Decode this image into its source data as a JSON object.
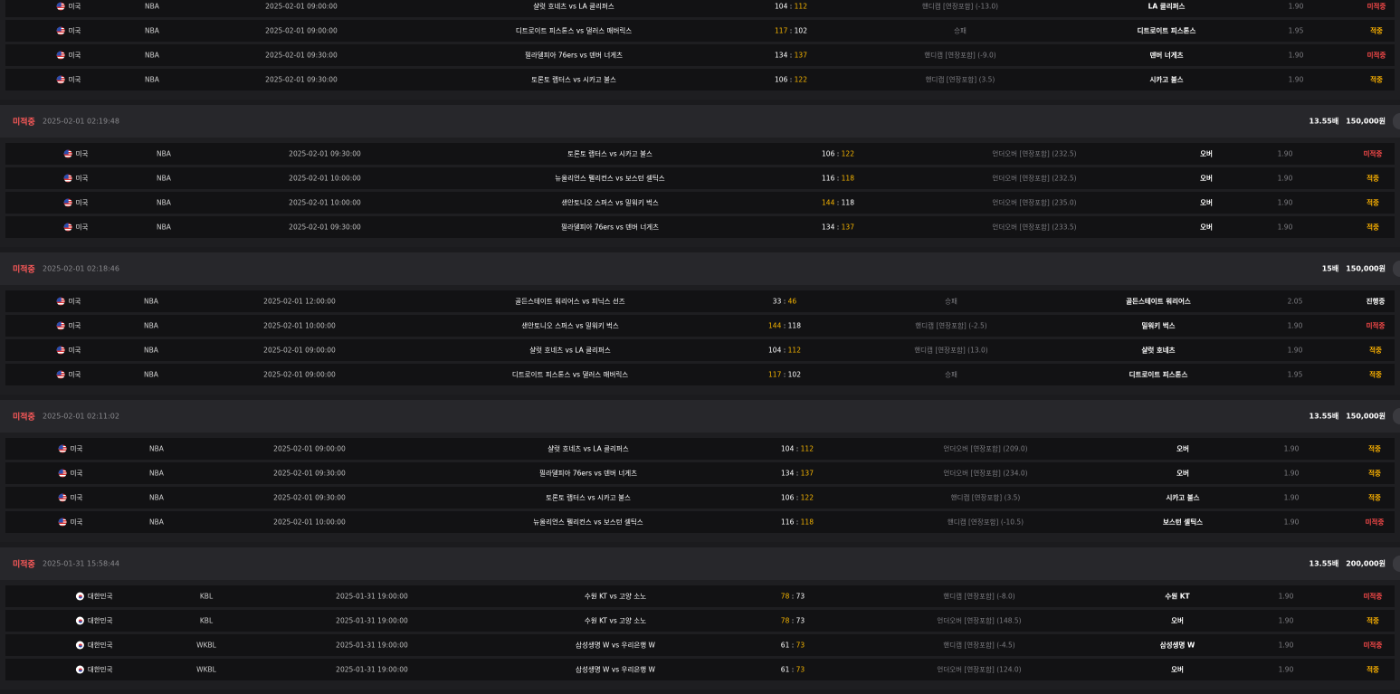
{
  "groups": [
    {
      "status": null,
      "bet_time": null,
      "odds_total": null,
      "stake": null,
      "rows": [
        {
          "country": "미국",
          "flag": "us-flag",
          "league": "NBA",
          "time": "2025-02-01 09:00:00",
          "match": "샬럿 호네츠 vs LA 클리퍼스",
          "score_home": "104",
          "score_away": "112",
          "hi": "away",
          "bet_type": "핸디캡 [연장포함] (-13.0)",
          "pick": "LA 클리퍼스",
          "odds": "1.90",
          "result": "미적중",
          "result_kind": "miss"
        },
        {
          "country": "미국",
          "flag": "us-flag",
          "league": "NBA",
          "time": "2025-02-01 09:00:00",
          "match": "디트로이트 피스톤스 vs 댈러스 매버릭스",
          "score_home": "117",
          "score_away": "102",
          "hi": "home",
          "bet_type": "승패",
          "pick": "디트로이트 피스톤스",
          "odds": "1.95",
          "result": "적중",
          "result_kind": "win"
        },
        {
          "country": "미국",
          "flag": "us-flag",
          "league": "NBA",
          "time": "2025-02-01 09:30:00",
          "match": "필라델피아 76ers vs 덴버 너게츠",
          "score_home": "134",
          "score_away": "137",
          "hi": "away",
          "bet_type": "핸디캡 [연장포함] (-9.0)",
          "pick": "덴버 너게츠",
          "odds": "1.90",
          "result": "미적중",
          "result_kind": "miss"
        },
        {
          "country": "미국",
          "flag": "us-flag",
          "league": "NBA",
          "time": "2025-02-01 09:30:00",
          "match": "토론토 랩터스 vs 시카고 불스",
          "score_home": "106",
          "score_away": "122",
          "hi": "away",
          "bet_type": "핸디캡 [연장포함] (3.5)",
          "pick": "시카고 불스",
          "odds": "1.90",
          "result": "적중",
          "result_kind": "win"
        }
      ]
    },
    {
      "status": "미적중",
      "bet_time": "2025-02-01 02:19:48",
      "odds_total": "13.55배",
      "stake": "150,000원",
      "rows": [
        {
          "country": "미국",
          "flag": "us-flag",
          "league": "NBA",
          "time": "2025-02-01 09:30:00",
          "match": "토론토 랩터스 vs 시카고 불스",
          "score_home": "106",
          "score_away": "122",
          "hi": "away",
          "bet_type": "언더오버 [연장포함] (232.5)",
          "pick": "오버",
          "odds": "1.90",
          "result": "미적중",
          "result_kind": "miss"
        },
        {
          "country": "미국",
          "flag": "us-flag",
          "league": "NBA",
          "time": "2025-02-01 10:00:00",
          "match": "뉴올리언스 펠리컨스 vs 보스턴 셀틱스",
          "score_home": "116",
          "score_away": "118",
          "hi": "away",
          "bet_type": "언더오버 [연장포함] (232.5)",
          "pick": "오버",
          "odds": "1.90",
          "result": "적중",
          "result_kind": "win"
        },
        {
          "country": "미국",
          "flag": "us-flag",
          "league": "NBA",
          "time": "2025-02-01 10:00:00",
          "match": "샌안토니오 스퍼스 vs 밀워키 벅스",
          "score_home": "144",
          "score_away": "118",
          "hi": "home",
          "bet_type": "언더오버 [연장포함] (235.0)",
          "pick": "오버",
          "odds": "1.90",
          "result": "적중",
          "result_kind": "win"
        },
        {
          "country": "미국",
          "flag": "us-flag",
          "league": "NBA",
          "time": "2025-02-01 09:30:00",
          "match": "필라델피아 76ers vs 덴버 너게츠",
          "score_home": "134",
          "score_away": "137",
          "hi": "away",
          "bet_type": "언더오버 [연장포함] (233.5)",
          "pick": "오버",
          "odds": "1.90",
          "result": "적중",
          "result_kind": "win"
        }
      ]
    },
    {
      "status": "미적중",
      "bet_time": "2025-02-01 02:18:46",
      "odds_total": "15배",
      "stake": "150,000원",
      "rows": [
        {
          "country": "미국",
          "flag": "us-flag",
          "league": "NBA",
          "time": "2025-02-01 12:00:00",
          "match": "골든스테이트 워리어스 vs 피닉스 선즈",
          "score_home": "33",
          "score_away": "46",
          "hi": "away",
          "bet_type": "승패",
          "pick": "골든스테이트 워리어스",
          "odds": "2.05",
          "result": "진행중",
          "result_kind": "live"
        },
        {
          "country": "미국",
          "flag": "us-flag",
          "league": "NBA",
          "time": "2025-02-01 10:00:00",
          "match": "샌안토니오 스퍼스 vs 밀워키 벅스",
          "score_home": "144",
          "score_away": "118",
          "hi": "home",
          "bet_type": "핸디캡 [연장포함] (-2.5)",
          "pick": "밀워키 벅스",
          "odds": "1.90",
          "result": "미적중",
          "result_kind": "miss"
        },
        {
          "country": "미국",
          "flag": "us-flag",
          "league": "NBA",
          "time": "2025-02-01 09:00:00",
          "match": "샬럿 호네츠 vs LA 클리퍼스",
          "score_home": "104",
          "score_away": "112",
          "hi": "away",
          "bet_type": "핸디캡 [연장포함] (13.0)",
          "pick": "샬럿 호네츠",
          "odds": "1.90",
          "result": "적중",
          "result_kind": "win"
        },
        {
          "country": "미국",
          "flag": "us-flag",
          "league": "NBA",
          "time": "2025-02-01 09:00:00",
          "match": "디트로이트 피스톤스 vs 댈러스 매버릭스",
          "score_home": "117",
          "score_away": "102",
          "hi": "home",
          "bet_type": "승패",
          "pick": "디트로이트 피스톤스",
          "odds": "1.95",
          "result": "적중",
          "result_kind": "win"
        }
      ]
    },
    {
      "status": "미적중",
      "bet_time": "2025-02-01 02:11:02",
      "odds_total": "13.55배",
      "stake": "150,000원",
      "rows": [
        {
          "country": "미국",
          "flag": "us-flag",
          "league": "NBA",
          "time": "2025-02-01 09:00:00",
          "match": "샬럿 호네츠 vs LA 클리퍼스",
          "score_home": "104",
          "score_away": "112",
          "hi": "away",
          "bet_type": "언더오버 [연장포함] (209.0)",
          "pick": "오버",
          "odds": "1.90",
          "result": "적중",
          "result_kind": "win"
        },
        {
          "country": "미국",
          "flag": "us-flag",
          "league": "NBA",
          "time": "2025-02-01 09:30:00",
          "match": "필라델피아 76ers vs 덴버 너게츠",
          "score_home": "134",
          "score_away": "137",
          "hi": "away",
          "bet_type": "언더오버 [연장포함] (234.0)",
          "pick": "오버",
          "odds": "1.90",
          "result": "적중",
          "result_kind": "win"
        },
        {
          "country": "미국",
          "flag": "us-flag",
          "league": "NBA",
          "time": "2025-02-01 09:30:00",
          "match": "토론토 랩터스 vs 시카고 불스",
          "score_home": "106",
          "score_away": "122",
          "hi": "away",
          "bet_type": "핸디캡 [연장포함] (3.5)",
          "pick": "시카고 불스",
          "odds": "1.90",
          "result": "적중",
          "result_kind": "win"
        },
        {
          "country": "미국",
          "flag": "us-flag",
          "league": "NBA",
          "time": "2025-02-01 10:00:00",
          "match": "뉴올리언스 펠리컨스 vs 보스턴 셀틱스",
          "score_home": "116",
          "score_away": "118",
          "hi": "away",
          "bet_type": "핸디캡 [연장포함] (-10.5)",
          "pick": "보스턴 셀틱스",
          "odds": "1.90",
          "result": "미적중",
          "result_kind": "miss"
        }
      ]
    },
    {
      "status": "미적중",
      "bet_time": "2025-01-31 15:58:44",
      "odds_total": "13.55배",
      "stake": "200,000원",
      "rows": [
        {
          "country": "대한민국",
          "flag": "korea-flag",
          "league": "KBL",
          "time": "2025-01-31 19:00:00",
          "match": "수원 KT vs 고양 소노",
          "score_home": "78",
          "score_away": "73",
          "hi": "home",
          "bet_type": "핸디캡 [연장포함] (-8.0)",
          "pick": "수원 KT",
          "odds": "1.90",
          "result": "미적중",
          "result_kind": "miss"
        },
        {
          "country": "대한민국",
          "flag": "korea-flag",
          "league": "KBL",
          "time": "2025-01-31 19:00:00",
          "match": "수원 KT vs 고양 소노",
          "score_home": "78",
          "score_away": "73",
          "hi": "home",
          "bet_type": "언더오버 [연장포함] (148.5)",
          "pick": "오버",
          "odds": "1.90",
          "result": "적중",
          "result_kind": "win"
        },
        {
          "country": "대한민국",
          "flag": "korea-flag",
          "league": "WKBL",
          "time": "2025-01-31 19:00:00",
          "match": "삼성생명 W vs 우리은행 W",
          "score_home": "61",
          "score_away": "73",
          "hi": "away",
          "bet_type": "핸디캡 [연장포함] (-4.5)",
          "pick": "삼성생명 W",
          "odds": "1.90",
          "result": "미적중",
          "result_kind": "miss"
        },
        {
          "country": "대한민국",
          "flag": "korea-flag",
          "league": "WKBL",
          "time": "2025-01-31 19:00:00",
          "match": "삼성생명 W vs 우리은행 W",
          "score_home": "61",
          "score_away": "73",
          "hi": "away",
          "bet_type": "언더오버 [연장포함] (124.0)",
          "pick": "오버",
          "odds": "1.90",
          "result": "적중",
          "result_kind": "win"
        }
      ]
    }
  ],
  "colors": {
    "miss": "#ff4b4b",
    "win": "#ffb400",
    "score_highlight": "#f5b400",
    "header_status": "#ff5a5a"
  }
}
